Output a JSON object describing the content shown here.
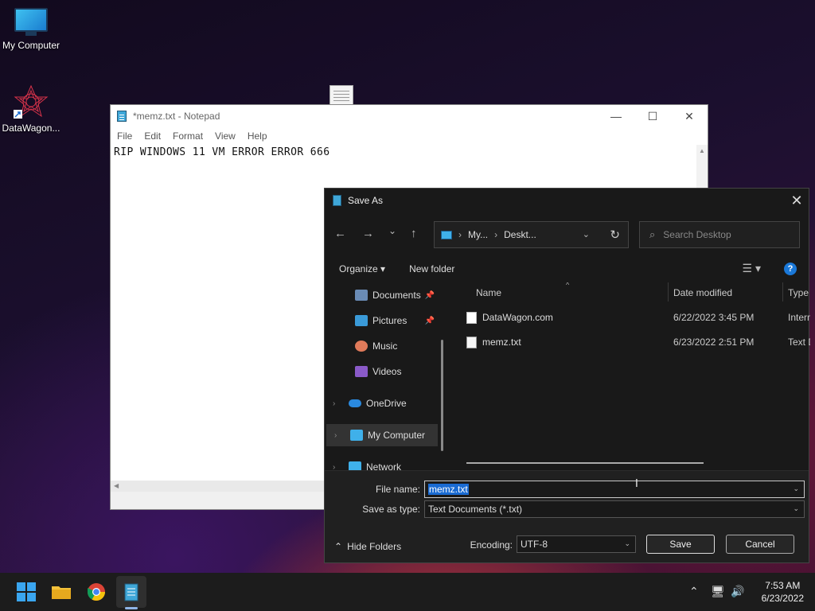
{
  "desktop": {
    "icons": [
      {
        "label": "My Computer"
      },
      {
        "label": "DataWagon..."
      }
    ]
  },
  "notepad": {
    "title": "*memz.txt - Notepad",
    "menu": [
      "File",
      "Edit",
      "Format",
      "View",
      "Help"
    ],
    "content": "RIP WINDOWS 11 VM ERROR ERROR 666",
    "window_buttons": {
      "minimize": "—",
      "maximize": "☐",
      "close": "✕"
    }
  },
  "save_dialog": {
    "title": "Save As",
    "close": "✕",
    "nav": {
      "back": "←",
      "forward": "→",
      "recent": "⌄",
      "up": "↑"
    },
    "breadcrumb": [
      "My...",
      "Deskt..."
    ],
    "search_placeholder": "Search Desktop",
    "toolbar": {
      "organize": "Organize ▾",
      "new_folder": "New folder",
      "help": "?"
    },
    "nav_pane": [
      {
        "label": "Documents",
        "pinned": true,
        "color": "#6a8bb5"
      },
      {
        "label": "Pictures",
        "pinned": true,
        "color": "#3a9ad8"
      },
      {
        "label": "Music",
        "pinned": false,
        "color": "#e07a5a"
      },
      {
        "label": "Videos",
        "pinned": false,
        "color": "#8a5ac8"
      },
      {
        "label": "OneDrive",
        "pinned": false,
        "color": "#2a8ae0"
      },
      {
        "label": "My Computer",
        "pinned": false,
        "color": "#3fb0ea"
      },
      {
        "label": "Network",
        "pinned": false,
        "color": "#3fb0ea"
      }
    ],
    "columns": {
      "name": "Name",
      "date": "Date modified",
      "type": "Type"
    },
    "files": [
      {
        "name": "DataWagon.com",
        "date": "6/22/2022 3:45 PM",
        "type": "Intern"
      },
      {
        "name": "memz.txt",
        "date": "6/23/2022 2:51 PM",
        "type": "Text D"
      }
    ],
    "file_name_label": "File name:",
    "file_name_value": "memz.txt",
    "save_type_label": "Save as type:",
    "save_type_value": "Text Documents (*.txt)",
    "hide_folders": "Hide Folders",
    "encoding_label": "Encoding:",
    "encoding_value": "UTF-8",
    "save_button": "Save",
    "cancel_button": "Cancel"
  },
  "taskbar": {
    "time": "7:53 AM",
    "date": "6/23/2022"
  },
  "colors": {
    "accent": "#1a6bd2",
    "dialog_bg": "#191919",
    "taskbar_bg": "#1c1c1c"
  }
}
